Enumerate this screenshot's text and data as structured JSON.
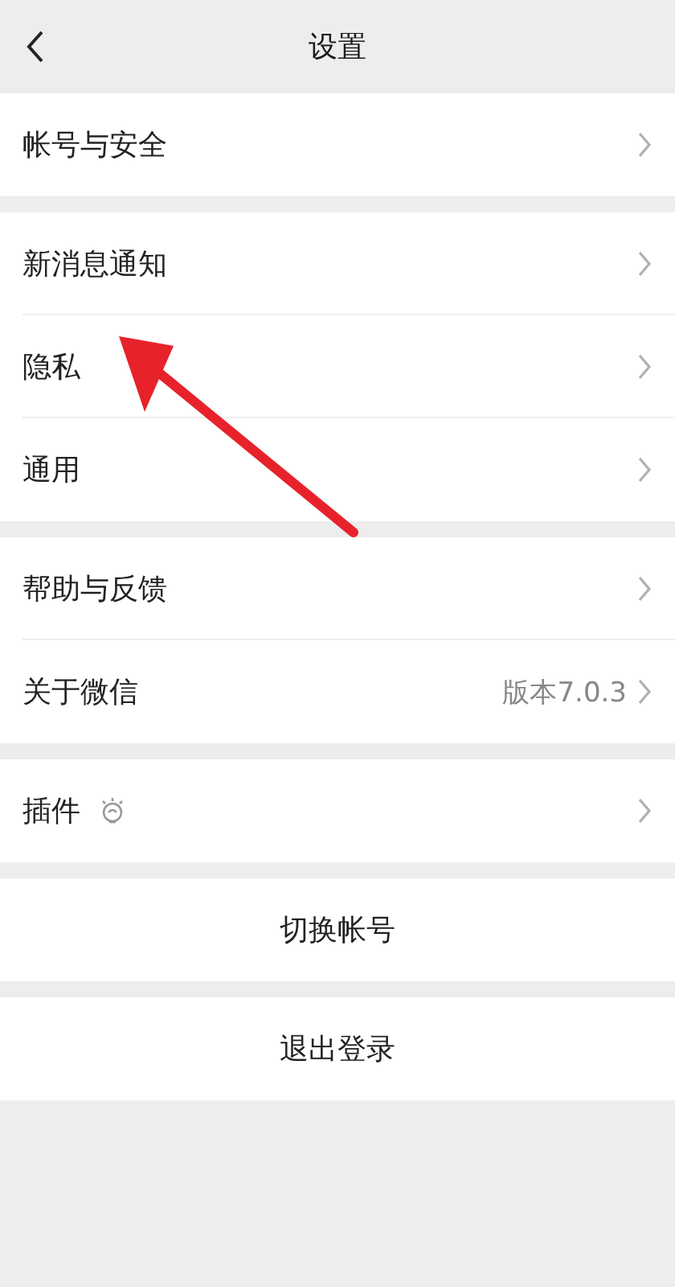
{
  "header": {
    "title": "设置"
  },
  "groups": [
    [
      {
        "label": "帐号与安全",
        "icon": false
      }
    ],
    [
      {
        "label": "新消息通知",
        "icon": false
      },
      {
        "label": "隐私",
        "icon": false
      },
      {
        "label": "通用",
        "icon": false
      }
    ],
    [
      {
        "label": "帮助与反馈",
        "icon": false
      },
      {
        "label": "关于微信",
        "value": "版本7.0.3",
        "icon": false
      }
    ],
    [
      {
        "label": "插件",
        "icon": true
      }
    ]
  ],
  "buttons": [
    "切换帐号",
    "退出登录"
  ],
  "annotation_arrow": true
}
